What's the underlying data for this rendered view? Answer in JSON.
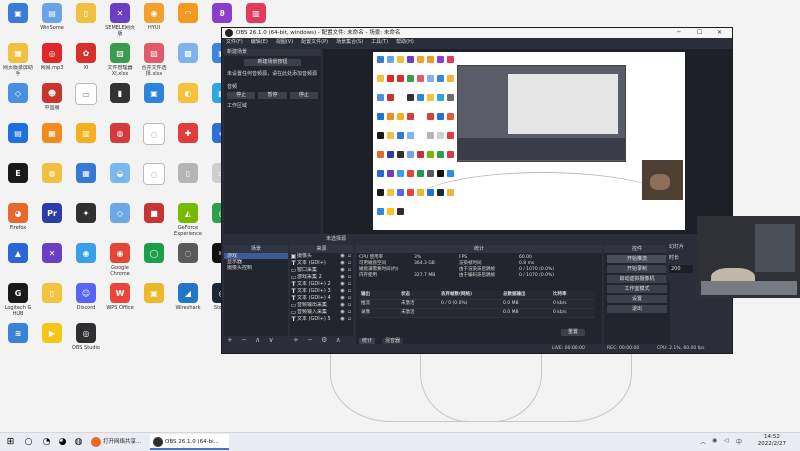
{
  "desktop": {
    "icons": [
      {
        "label": "",
        "color": "#3a7bd5",
        "glyph": "▣"
      },
      {
        "label": "WinSome",
        "color": "#6aa3e8",
        "glyph": "▤"
      },
      {
        "label": "",
        "color": "#f0c040",
        "glyph": "▯"
      },
      {
        "label": "SEMELE网页版",
        "color": "#6a3fc4",
        "glyph": "✕"
      },
      {
        "label": "HYUI",
        "color": "#f3a12b",
        "glyph": "◉"
      },
      {
        "label": "",
        "color": "#f29a1f",
        "glyph": "◠"
      },
      {
        "label": "",
        "color": "#8a3ec9",
        "glyph": "ϑ"
      },
      {
        "label": "",
        "color": "#e33b5c",
        "glyph": "▥"
      },
      {
        "label": "网页版录屏助手",
        "color": "#f0c040",
        "glyph": "▦"
      },
      {
        "label": "网易.mp3",
        "color": "#e02828",
        "glyph": "◎"
      },
      {
        "label": "XI",
        "color": "#d9302c",
        "glyph": "✿"
      },
      {
        "label": "文件管理器XI.xlsx",
        "color": "#3c9c4e",
        "glyph": "▧"
      },
      {
        "label": "合并文件选择.xlsx",
        "color": "#e05a6a",
        "glyph": "▨"
      },
      {
        "label": "",
        "color": "#7fb2ef",
        "glyph": "▩"
      },
      {
        "label": "",
        "color": "#3d83e0",
        "glyph": "▣"
      },
      {
        "label": "网络设备驱动",
        "color": "#f2b630",
        "glyph": "◆"
      },
      {
        "label": "",
        "color": "#4b8fe2",
        "glyph": "◇"
      },
      {
        "label": "中国服",
        "color": "#c9352c",
        "glyph": "☻"
      },
      {
        "label": "",
        "color": "#ffffff",
        "glyph": "▭"
      },
      {
        "label": "",
        "color": "#333333",
        "glyph": "▮"
      },
      {
        "label": "",
        "color": "#2d84d8",
        "glyph": "▣"
      },
      {
        "label": "",
        "color": "#f5c23a",
        "glyph": "◐"
      },
      {
        "label": "",
        "color": "#2ea6e0",
        "glyph": "▦"
      },
      {
        "label": "",
        "color": "#6d6d6d",
        "glyph": "▰"
      },
      {
        "label": "",
        "color": "#1f6fe0",
        "glyph": "▤"
      },
      {
        "label": "",
        "color": "#f28a1f",
        "glyph": "▦"
      },
      {
        "label": "",
        "color": "#f5b01f",
        "glyph": "▥"
      },
      {
        "label": "",
        "color": "#d63b3b",
        "glyph": "◍"
      },
      {
        "label": "",
        "color": "#ffffff",
        "glyph": "◌"
      },
      {
        "label": "",
        "color": "#e03c3c",
        "glyph": "✚"
      },
      {
        "label": "",
        "color": "#2f6ed6",
        "glyph": "◈"
      },
      {
        "label": "",
        "color": "#e55a3a",
        "glyph": "⚑"
      },
      {
        "label": "",
        "color": "#1a1a1a",
        "glyph": "E"
      },
      {
        "label": "",
        "color": "#f0c040",
        "glyph": "◍"
      },
      {
        "label": "",
        "color": "#3778d4",
        "glyph": "▦"
      },
      {
        "label": "",
        "color": "#79b7f0",
        "glyph": "◒"
      },
      {
        "label": "",
        "color": "#ffffff",
        "glyph": "◌"
      },
      {
        "label": "",
        "color": "#b5b5b5",
        "glyph": "▯"
      },
      {
        "label": "",
        "color": "#cfcfcf",
        "glyph": "▭"
      },
      {
        "label": "",
        "color": "#e33b3b",
        "glyph": "◎"
      },
      {
        "label": "Firefox",
        "color": "#e8672a",
        "glyph": "◕"
      },
      {
        "label": "",
        "color": "#2c3ca8",
        "glyph": "Pr"
      },
      {
        "label": "",
        "color": "#303030",
        "glyph": "✦"
      },
      {
        "label": "",
        "color": "#6fa8e8",
        "glyph": "◇"
      },
      {
        "label": "",
        "color": "#c73434",
        "glyph": "■"
      },
      {
        "label": "GeForce Experience",
        "color": "#76b900",
        "glyph": "◭"
      },
      {
        "label": "",
        "color": "#2ea04b",
        "glyph": "◎"
      },
      {
        "label": "",
        "color": "#d83a48",
        "glyph": "◐"
      },
      {
        "label": "",
        "color": "#2a66d8",
        "glyph": "▲"
      },
      {
        "label": "",
        "color": "#6a3fc4",
        "glyph": "✕"
      },
      {
        "label": "",
        "color": "#37a0e8",
        "glyph": "◉"
      },
      {
        "label": "Google Chrome",
        "color": "#e24637",
        "glyph": "◉"
      },
      {
        "label": "",
        "color": "#1c9f4c",
        "glyph": "◯"
      },
      {
        "label": "",
        "color": "#5a5a5a",
        "glyph": "◌"
      },
      {
        "label": "",
        "color": "#111111",
        "glyph": "✂"
      },
      {
        "label": "",
        "color": "#2d8de0",
        "glyph": "◢"
      },
      {
        "label": "Logitech G HUB",
        "color": "#1a1a1a",
        "glyph": "G"
      },
      {
        "label": "",
        "color": "#f2c441",
        "glyph": "▯"
      },
      {
        "label": "Discord",
        "color": "#5865f2",
        "glyph": "☺"
      },
      {
        "label": "WPS Office",
        "color": "#e9453a",
        "glyph": "W"
      },
      {
        "label": "",
        "color": "#e9b92a",
        "glyph": "▣"
      },
      {
        "label": "Wireshark",
        "color": "#2276c9",
        "glyph": "◢"
      },
      {
        "label": "Steam",
        "color": "#1b2838",
        "glyph": "◎"
      },
      {
        "label": "",
        "color": "#e2b93c",
        "glyph": "▯"
      },
      {
        "label": "",
        "color": "#3a82d6",
        "glyph": "≋"
      },
      {
        "label": "",
        "color": "#f5c518",
        "glyph": "▶"
      },
      {
        "label": "OBS Studio",
        "color": "#302e31",
        "glyph": "◎"
      }
    ]
  },
  "obs": {
    "title": "OBS 26.1.0 (64-bit, windows) - 配置文件: 未命名 - 场景: 未命名",
    "window_controls": [
      "─",
      "☐",
      "✕"
    ],
    "menu": [
      "文件(F)",
      "编辑(E)",
      "视图(V)",
      "配置文件(P)",
      "场景集合(S)",
      "工具(T)",
      "帮助(H)"
    ],
    "left_dock": {
      "title": "新建场景",
      "button": "新建场景按钮",
      "message": "未设置任何音频源，请在此处添加音频源",
      "section": "音频",
      "buttons": [
        "停止",
        "暂停",
        "停止"
      ],
      "footer": "工作区域"
    },
    "preview_label": "未选择源",
    "scenes_panel": {
      "title": "场景",
      "items": [
        "游戏",
        "显示器",
        "摄像头控制"
      ],
      "footer": "+ − ∧ ∨"
    },
    "sources_panel": {
      "title": "来源",
      "items": [
        {
          "type": "▣",
          "name": "摄像头"
        },
        {
          "type": "T",
          "name": "文本 (GDI+)"
        },
        {
          "type": "▭",
          "name": "窗口采集"
        },
        {
          "type": "▭",
          "name": "游戏采集 2"
        },
        {
          "type": "T",
          "name": "文本 (GDI+) 2"
        },
        {
          "type": "T",
          "name": "文本 (GDI+) 3"
        },
        {
          "type": "T",
          "name": "文本 (GDI+) 4"
        },
        {
          "type": "▭",
          "name": "音频输出采集"
        },
        {
          "type": "▭",
          "name": "音频输入采集"
        },
        {
          "type": "T",
          "name": "文本 (GDI+) 5"
        }
      ],
      "footer": "+ − ⚙ ∧ ∨"
    },
    "stats": {
      "title": "统计",
      "rows": [
        [
          "CPU 使用率",
          "3%",
          "FPS",
          "60.00"
        ],
        [
          "可用磁盘空间",
          "364.3 GB",
          "渲染帧时间",
          "0.8 ms"
        ],
        [
          "磁盘满需要时间(约)",
          "",
          "由于渲染滞后跳帧",
          "0 / 1070 (0.0%)"
        ],
        [
          "内存使用",
          "327.7 MB",
          "由于编码滞后跳帧",
          "0 / 1070 (0.0%)"
        ]
      ],
      "table_headers": [
        "输出",
        "状态",
        "丢弃帧数(网络)",
        "总数据输出",
        "比特率"
      ],
      "table_rows": [
        [
          "推流",
          "未激活",
          "0 / 0 (0.0%)",
          "0.0 MB",
          "0 kb/s"
        ],
        [
          "录像",
          "未激活",
          "",
          "0.0 MB",
          "0 kb/s"
        ]
      ],
      "reset": "重置",
      "tabs": [
        "统计",
        "混音器"
      ]
    },
    "controls": {
      "title": "控件",
      "buttons": [
        "开始推流",
        "开始录制",
        "启动虚拟摄像机",
        "工作室模式",
        "设置",
        "退出"
      ]
    },
    "status": {
      "live": "LIVE: 00:00:00",
      "rec": "REC: 00:00:00",
      "cpu": "CPU: 2.1%, 60.00 fps"
    }
  },
  "side_widget": {
    "labels": [
      "幻灯片",
      "时长"
    ],
    "value": "200"
  },
  "taskbar": {
    "pinned": [
      {
        "name": "start",
        "glyph": "⊞",
        "color": "#1e6fd6"
      },
      {
        "name": "search",
        "glyph": "○",
        "color": "#444444"
      },
      {
        "name": "edge",
        "glyph": "◔",
        "color": "#1a8ad8"
      },
      {
        "name": "firefox",
        "glyph": "◕",
        "color": "#e8672a"
      },
      {
        "name": "wechat",
        "glyph": "◍",
        "color": "#2dc100"
      }
    ],
    "apps": [
      {
        "label": "打开网络共享...",
        "color": "#e8672a",
        "active": false
      },
      {
        "label": "OBS 26.1.0 (64-bi...",
        "color": "#302e31",
        "active": true
      }
    ],
    "time": "14:52",
    "date": "2022/2/27"
  }
}
